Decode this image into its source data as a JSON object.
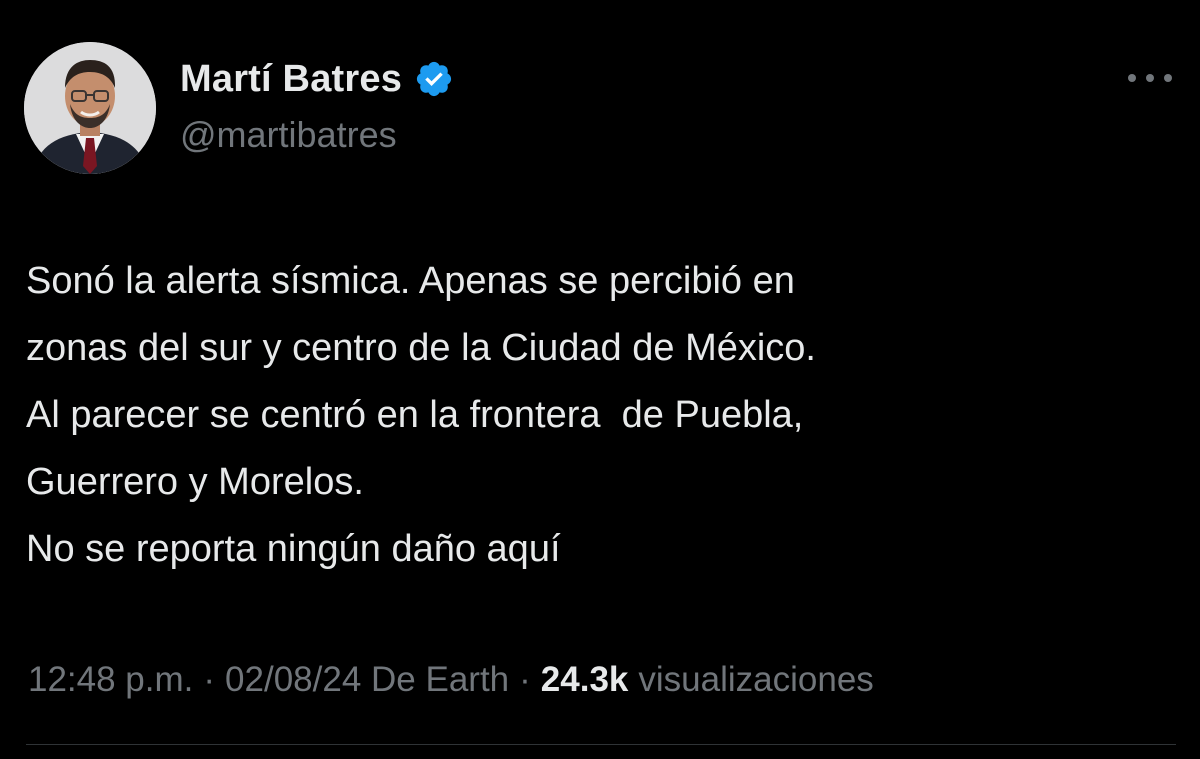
{
  "tweet": {
    "author": {
      "display_name": "Martí Batres",
      "handle": "@martibatres",
      "verified_icon": "verified-badge-icon",
      "verified_color": "#1d9bf0",
      "avatar_icon": "profile-photo"
    },
    "more_icon": "more-options-icon",
    "text_lines": [
      "Sonó la alerta sísmica. Apenas se percibió en",
      "zonas del sur y centro de la Ciudad de México.",
      "Al parecer se centró en la frontera  de Puebla,",
      "Guerrero y Morelos.",
      "No se reporta ningún daño aquí"
    ],
    "meta": {
      "time": "12:48 p.m.",
      "separator": "·",
      "date_source": "02/08/24 De Earth",
      "views_count": "24.3k",
      "views_label": "visualizaciones"
    }
  },
  "colors": {
    "background": "#000000",
    "primary_text": "#e7e9ea",
    "secondary_text": "#71767b",
    "accent": "#1d9bf0",
    "divider": "#2f3336"
  }
}
